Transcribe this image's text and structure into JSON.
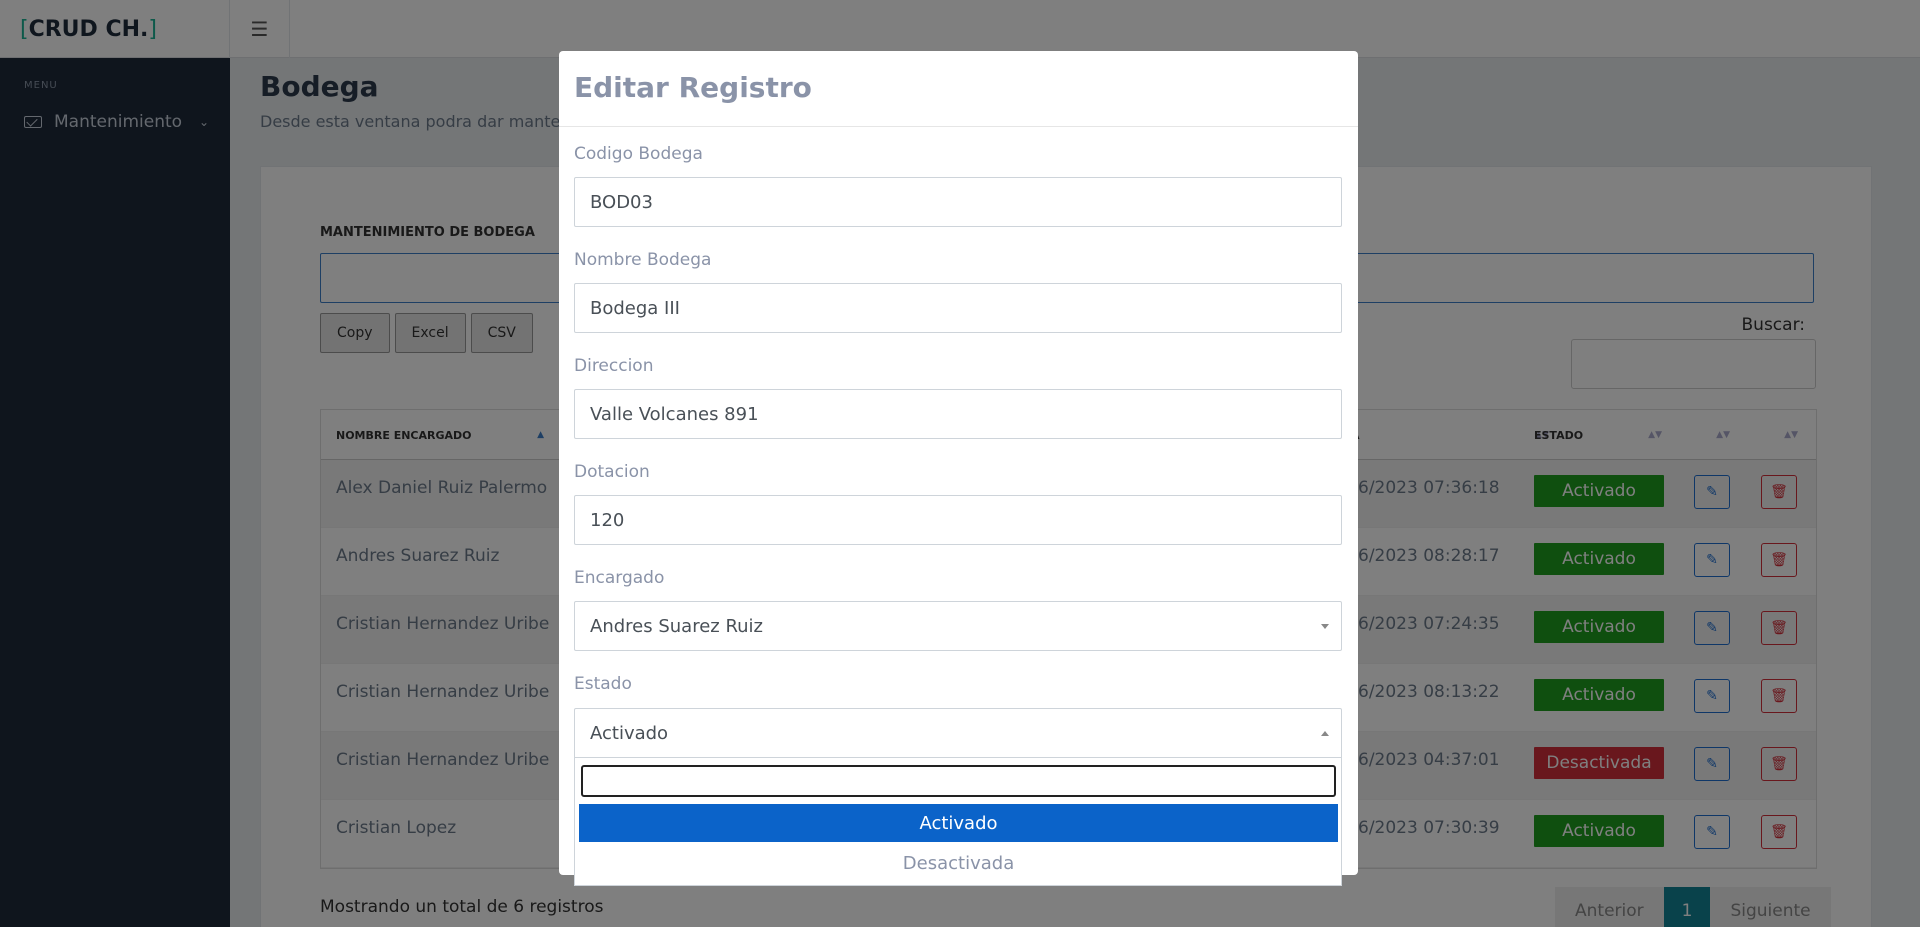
{
  "brand": {
    "bracket_open": "[",
    "name": "CRUD CH.",
    "bracket_close": "]"
  },
  "sidebar": {
    "menu_header": "MENU",
    "item_label": "Mantenimiento"
  },
  "page": {
    "title": "Bodega",
    "subtitle": "Desde esta ventana podra dar manteni"
  },
  "card": {
    "header": "MANTENIMIENTO DE BODEGA",
    "buttons": [
      "Copy",
      "Excel",
      "CSV"
    ],
    "search_label": "Buscar:"
  },
  "table": {
    "columns": {
      "encargado": "NOMBRE ENCARGADO",
      "fecha": "A",
      "estado": "ESTADO"
    },
    "rows": [
      {
        "name": "Alex Daniel Ruiz Palermo",
        "date": "6/2023 07:36:18",
        "status": "Activado"
      },
      {
        "name": "Andres Suarez Ruiz",
        "date": "6/2023 08:28:17",
        "status": "Activado"
      },
      {
        "name": "Cristian Hernandez Uribe",
        "date": "6/2023 07:24:35",
        "status": "Activado"
      },
      {
        "name": "Cristian Hernandez Uribe",
        "date": "6/2023 08:13:22",
        "status": "Activado"
      },
      {
        "name": "Cristian Hernandez Uribe",
        "date": "6/2023 04:37:01",
        "status": "Desactivada"
      },
      {
        "name": "Cristian Lopez",
        "date": "6/2023 07:30:39",
        "status": "Activado"
      }
    ]
  },
  "footer": {
    "info": "Mostrando un total de 6 registros",
    "prev": "Anterior",
    "page": "1",
    "next": "Siguiente"
  },
  "modal": {
    "title": "Editar Registro",
    "fields": {
      "codigo": {
        "label": "Codigo Bodega",
        "value": "BOD03"
      },
      "nombre": {
        "label": "Nombre Bodega",
        "value": "Bodega III"
      },
      "direccion": {
        "label": "Direccion",
        "value": "Valle Volcanes 891"
      },
      "dotacion": {
        "label": "Dotacion",
        "value": "120"
      },
      "encargado": {
        "label": "Encargado",
        "value": "Andres Suarez Ruiz"
      },
      "estado": {
        "label": "Estado",
        "value": "Activado"
      }
    },
    "estado_options": [
      "Activado",
      "Desactivada"
    ]
  },
  "colors": {
    "activado": "#1e9e1e",
    "desactivada": "#d32f3a",
    "selected_option": "#0b63c9",
    "current_page": "#138496"
  }
}
